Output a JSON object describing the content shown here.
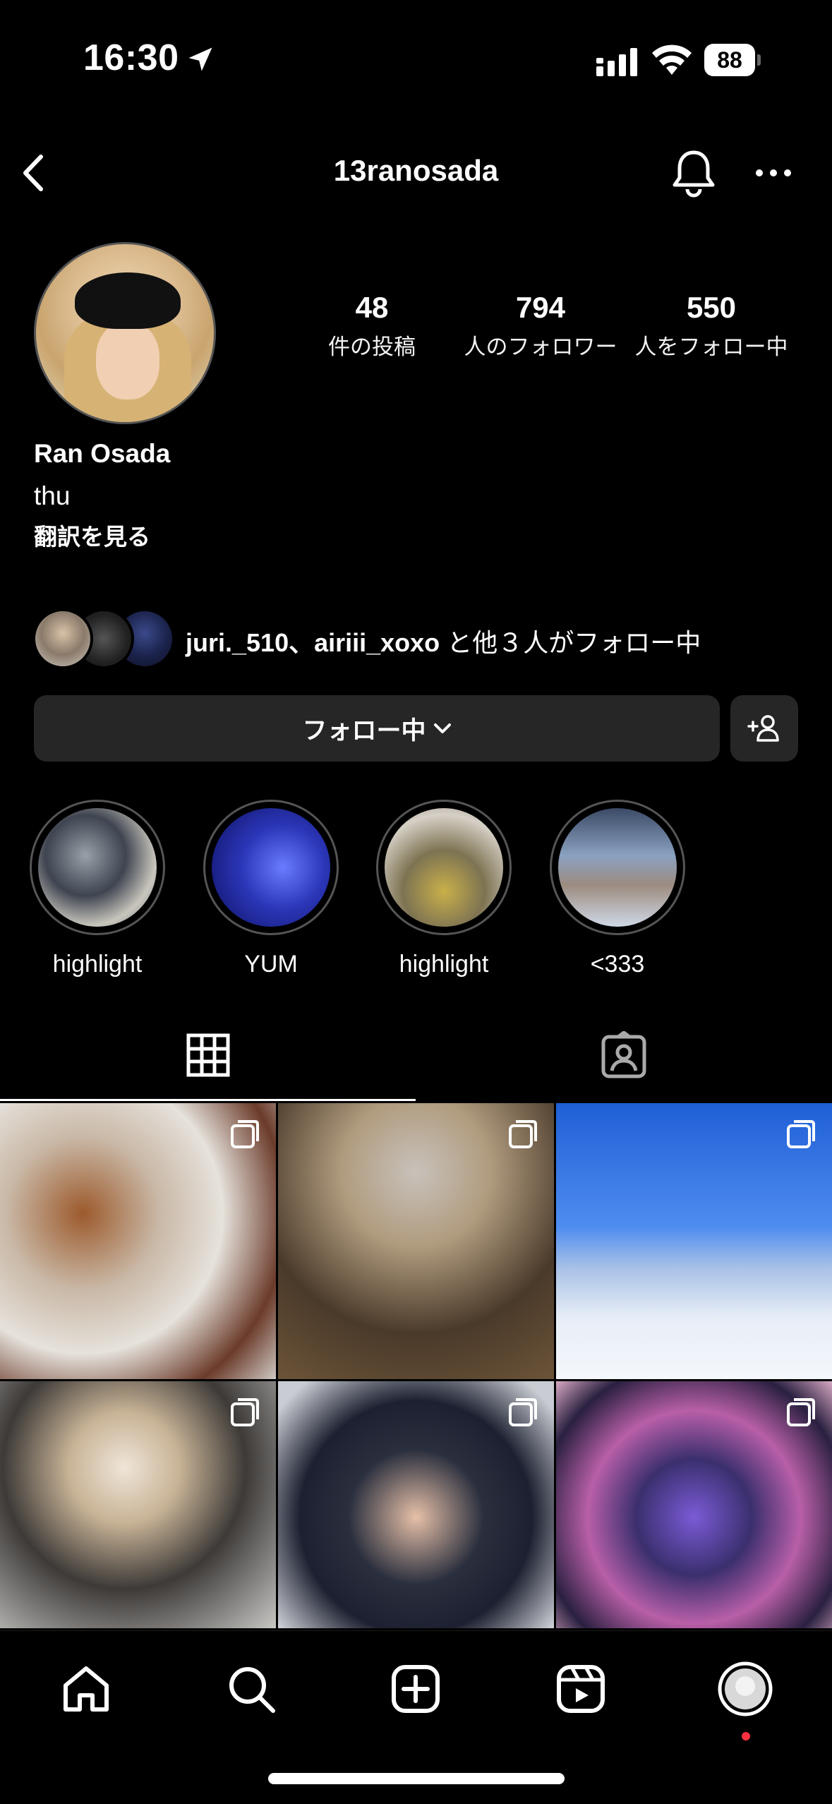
{
  "status_bar": {
    "time": "16:30",
    "battery": "88"
  },
  "header": {
    "username": "13ranosada"
  },
  "profile": {
    "stats": [
      {
        "value": "48",
        "label": "件の投稿"
      },
      {
        "value": "794",
        "label": "人のフォロワー"
      },
      {
        "value": "550",
        "label": "人をフォロー中"
      }
    ],
    "display_name": "Ran Osada",
    "bio": "thu",
    "translate_label": "翻訳を見る"
  },
  "followed_by": {
    "names": "juri._510、airiii_xoxo",
    "suffix": " と他３人がフォロー中"
  },
  "actions": {
    "following_label": "フォロー中"
  },
  "highlights": [
    {
      "label": "highlight"
    },
    {
      "label": "YUM"
    },
    {
      "label": "highlight"
    },
    {
      "label": "<333"
    }
  ],
  "colors": {
    "background": "#000000",
    "button_bg": "#262626",
    "notification_dot": "#ff3040"
  },
  "icons": [
    "location-arrow-icon",
    "signal-icon",
    "wifi-icon",
    "back-chevron-icon",
    "bell-icon",
    "more-icon",
    "add-person-icon",
    "grid-icon",
    "tagged-icon",
    "multi-photo-icon",
    "home-icon",
    "search-icon",
    "create-icon",
    "reels-icon",
    "profile-avatar-icon"
  ]
}
